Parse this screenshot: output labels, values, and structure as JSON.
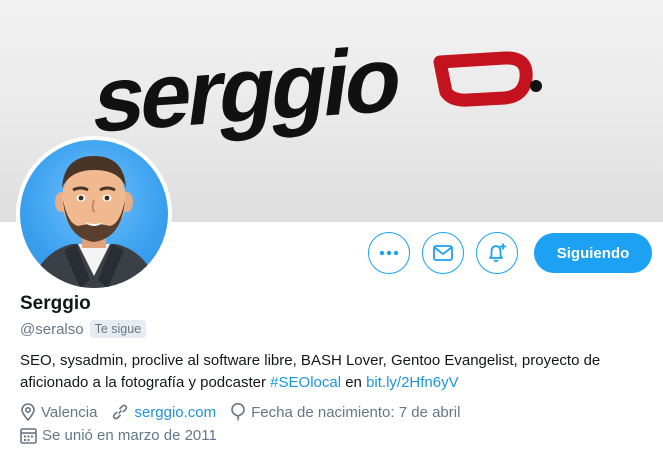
{
  "banner": {
    "logo_text": "serggio",
    "logo_dot": "."
  },
  "profile": {
    "name": "Serggio",
    "handle": "@seralso",
    "follows_you": "Te sigue",
    "bio_text": "SEO, sysadmin, proclive al software libre, BASH Lover, Gentoo Evangelist, proyecto de aficionado a la fotografía y podcaster ",
    "bio_hashtag": "#SEOlocal",
    "bio_connector": " en ",
    "bio_link": "bit.ly/2Hfn6yV",
    "location": "Valencia",
    "website": "serggio.com",
    "birthdate": "Fecha de nacimiento: 7 de abril",
    "joined": "Se unió en marzo de 2011"
  },
  "actions": {
    "more": "more-icon",
    "message": "envelope-icon",
    "notify": "bell-plus-icon",
    "follow_label": "Siguiendo"
  },
  "colors": {
    "accent": "#1da1f2",
    "link": "#1b95e0",
    "muted": "#657786",
    "logo_dark": "#111111",
    "logo_red": "#c4121f"
  }
}
